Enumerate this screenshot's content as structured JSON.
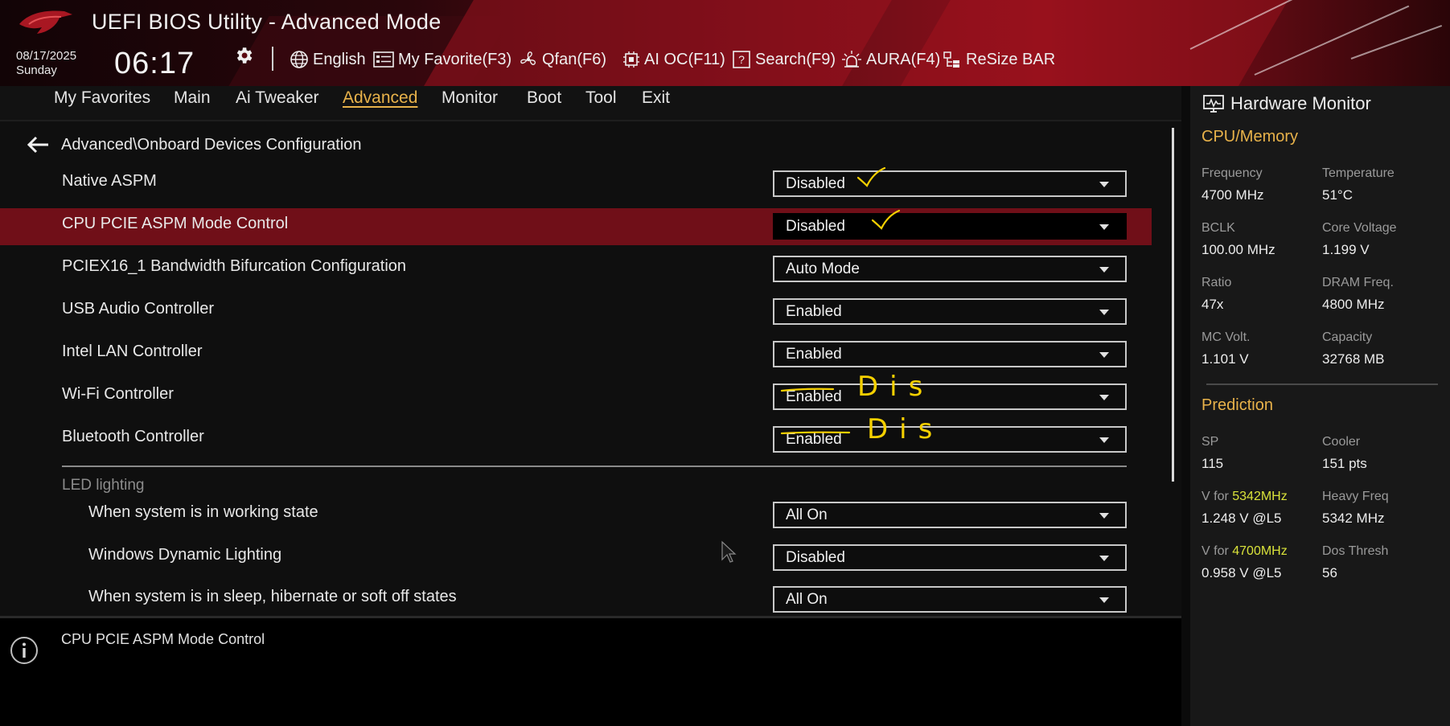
{
  "header": {
    "title": "UEFI BIOS Utility - Advanced Mode",
    "date": "08/17/2025",
    "day": "Sunday",
    "time": "06:17",
    "tools": [
      {
        "label": "English",
        "icon": "globe-icon"
      },
      {
        "label": "My Favorite(F3)",
        "icon": "favorite-list-icon"
      },
      {
        "label": "Qfan(F6)",
        "icon": "fan-icon"
      },
      {
        "label": "AI OC(F11)",
        "icon": "ai-chip-icon"
      },
      {
        "label": "Search(F9)",
        "icon": "search-question-icon"
      },
      {
        "label": "AURA(F4)",
        "icon": "aura-light-icon"
      },
      {
        "label": "ReSize BAR",
        "icon": "resize-bar-icon"
      }
    ]
  },
  "nav": {
    "tabs": [
      "My Favorites",
      "Main",
      "Ai Tweaker",
      "Advanced",
      "Monitor",
      "Boot",
      "Tool",
      "Exit"
    ],
    "active": "Advanced"
  },
  "main": {
    "breadcrumb": "Advanced\\Onboard Devices Configuration",
    "settings": [
      {
        "label": "Native ASPM",
        "value": "Disabled"
      },
      {
        "label": "CPU PCIE ASPM Mode Control",
        "value": "Disabled"
      },
      {
        "label": "PCIEX16_1 Bandwidth Bifurcation Configuration",
        "value": "Auto Mode"
      },
      {
        "label": "USB Audio Controller",
        "value": "Enabled"
      },
      {
        "label": "Intel LAN Controller",
        "value": "Enabled"
      },
      {
        "label": "Wi-Fi Controller",
        "value": "Enabled"
      },
      {
        "label": "Bluetooth Controller",
        "value": "Enabled"
      }
    ],
    "section_title": "LED lighting",
    "led_settings": [
      {
        "label": "When system is in working state",
        "value": "All On"
      },
      {
        "label": "Windows Dynamic Lighting",
        "value": "Disabled"
      },
      {
        "label": "When system is in sleep, hibernate or soft off states",
        "value": "All On"
      }
    ],
    "annotations": {
      "wifi_note": "Dis",
      "bt_note": "Dis"
    }
  },
  "help": {
    "text": "CPU PCIE ASPM Mode Control"
  },
  "hardware_monitor": {
    "title": "Hardware Monitor",
    "cpu_memory": {
      "heading": "CPU/Memory",
      "frequency_label": "Frequency",
      "frequency": "4700 MHz",
      "temperature_label": "Temperature",
      "temperature": "51°C",
      "bclk_label": "BCLK",
      "bclk": "100.00 MHz",
      "core_voltage_label": "Core Voltage",
      "core_voltage": "1.199 V",
      "ratio_label": "Ratio",
      "ratio": "47x",
      "dram_freq_label": "DRAM Freq.",
      "dram_freq": "4800 MHz",
      "mc_volt_label": "MC Volt.",
      "mc_volt": "1.101 V",
      "capacity_label": "Capacity",
      "capacity": "32768 MB"
    },
    "prediction": {
      "heading": "Prediction",
      "sp_label": "SP",
      "sp": "115",
      "cooler_label": "Cooler",
      "cooler": "151 pts",
      "v_for_label": "V for",
      "v_for_1_freq": "5342MHz",
      "v_for_1": "1.248 V @L5",
      "heavy_freq_label": "Heavy Freq",
      "heavy_freq": "5342 MHz",
      "v_for_2_freq": "4700MHz",
      "v_for_2": "0.958 V @L5",
      "dos_thresh_label": "Dos Thresh",
      "dos_thresh": "56"
    }
  },
  "colors": {
    "accent": "#e8b24a",
    "selected_row": "#700f18",
    "annotation": "#f5d000",
    "highlight_freq": "#d9e23a"
  }
}
